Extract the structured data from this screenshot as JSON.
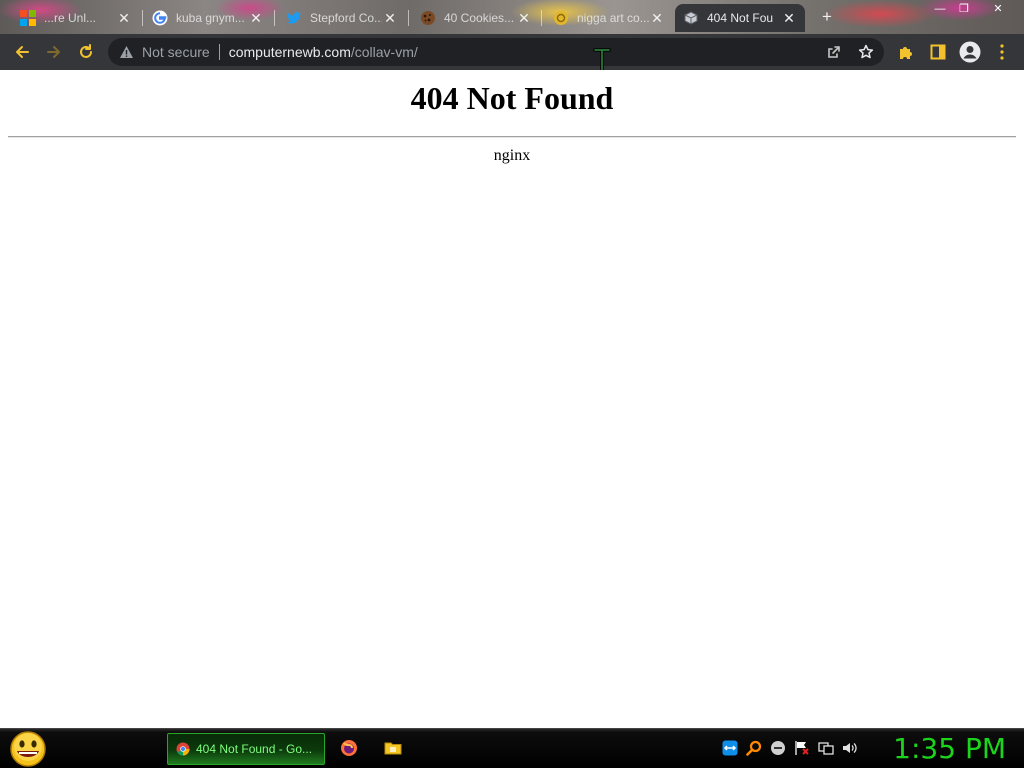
{
  "browser": {
    "tabs": [
      {
        "title": "...re Unl...",
        "favicon": "microsoft-icon"
      },
      {
        "title": "kuba gnym...",
        "favicon": "google-icon"
      },
      {
        "title": "Stepford Co...",
        "favicon": "twitter-icon"
      },
      {
        "title": "40 Cookies...",
        "favicon": "cookie-icon"
      },
      {
        "title": "nigga art co...",
        "favicon": "yellow-favicon"
      },
      {
        "title": "404 Not Fou",
        "favicon": "page-favicon",
        "active": true
      }
    ],
    "address_bar": {
      "security_label": "Not secure",
      "host": "computernewb.com",
      "path": "/collav-vm/"
    },
    "colors": {
      "frame": "#35363a",
      "omnibox": "#202124",
      "accent_icon": "#f2c12e"
    }
  },
  "page": {
    "heading": "404 Not Found",
    "server": "nginx"
  },
  "taskbar": {
    "active_task_label": "404 Not Found - Go...",
    "quick_launch": [
      "firefox-icon",
      "folder-icon"
    ],
    "tray_icons": [
      "teamviewer-icon",
      "search-icon",
      "network-status-icon",
      "flag-icon",
      "display-icon",
      "volume-icon"
    ],
    "clock": "1:35 PM",
    "colors": {
      "clock": "#1cd41c",
      "task_text": "#7dff7d"
    }
  }
}
